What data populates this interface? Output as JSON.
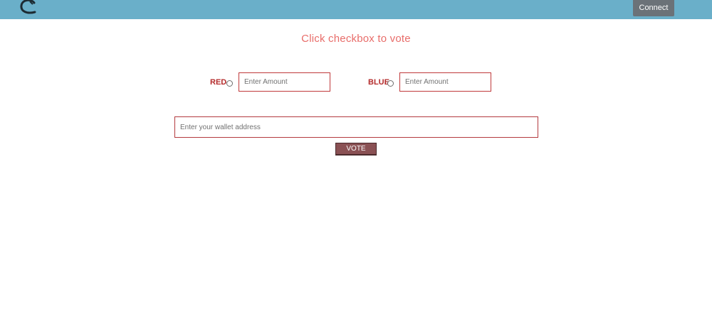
{
  "header": {
    "logo_icon": "c-logo-icon",
    "connect_label": "Connect",
    "background_color": "#6aafc9"
  },
  "main": {
    "title": "Click checkbox to vote",
    "options": [
      {
        "label": "RED",
        "amount_placeholder": "Enter Amount"
      },
      {
        "label": "BLUE",
        "amount_placeholder": "Enter Amount"
      }
    ],
    "wallet_placeholder": "Enter your wallet address",
    "vote_label": "VOTE"
  }
}
